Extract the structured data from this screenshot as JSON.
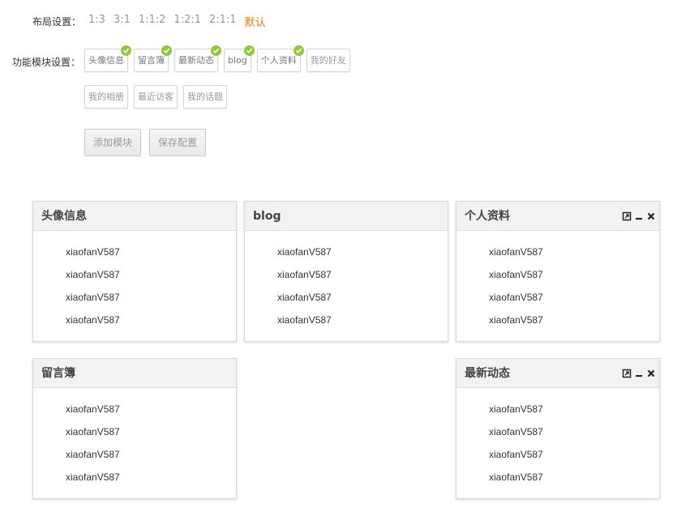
{
  "layout_setting": {
    "label": "布局设置：",
    "options": [
      "1:3",
      "3:1",
      "1:1:2",
      "1:2:1",
      "2:1:1",
      "默认"
    ],
    "active_option": "默认"
  },
  "module_setting": {
    "label": "功能模块设置：",
    "modules_row1": [
      {
        "label": "头像信息",
        "checked": true
      },
      {
        "label": "留言簿",
        "checked": true
      },
      {
        "label": "最新动态",
        "checked": true
      },
      {
        "label": "blog",
        "checked": true
      },
      {
        "label": "个人资料",
        "checked": true
      },
      {
        "label": "我的好友",
        "checked": false
      }
    ],
    "modules_row2": [
      {
        "label": "我的相册",
        "checked": false
      },
      {
        "label": "最近访客",
        "checked": false
      },
      {
        "label": "我的话题",
        "checked": false
      }
    ]
  },
  "actions": {
    "add_label": "添加模块",
    "save_label": "保存配置"
  },
  "panels": [
    {
      "title": "头像信息",
      "show_tools": false,
      "items": [
        "xiaofanV587",
        "xiaofanV587",
        "xiaofanV587",
        "xiaofanV587"
      ]
    },
    {
      "title": "blog",
      "show_tools": false,
      "items": [
        "xiaofanV587",
        "xiaofanV587",
        "xiaofanV587",
        "xiaofanV587"
      ]
    },
    {
      "title": "个人资料",
      "show_tools": true,
      "items": [
        "xiaofanV587",
        "xiaofanV587",
        "xiaofanV587",
        "xiaofanV587"
      ]
    },
    {
      "title": "留言簿",
      "show_tools": false,
      "items": [
        "xiaofanV587",
        "xiaofanV587",
        "xiaofanV587",
        "xiaofanV587"
      ]
    },
    {
      "title": "最新动态",
      "show_tools": true,
      "items": [
        "xiaofanV587",
        "xiaofanV587",
        "xiaofanV587",
        "xiaofanV587"
      ]
    }
  ],
  "colors": {
    "accent": "#f07800",
    "check": "#8fc93a"
  },
  "icons": {
    "panel_tools": [
      "restore-icon",
      "minimize-icon",
      "close-icon"
    ],
    "module_check": "check-icon"
  }
}
